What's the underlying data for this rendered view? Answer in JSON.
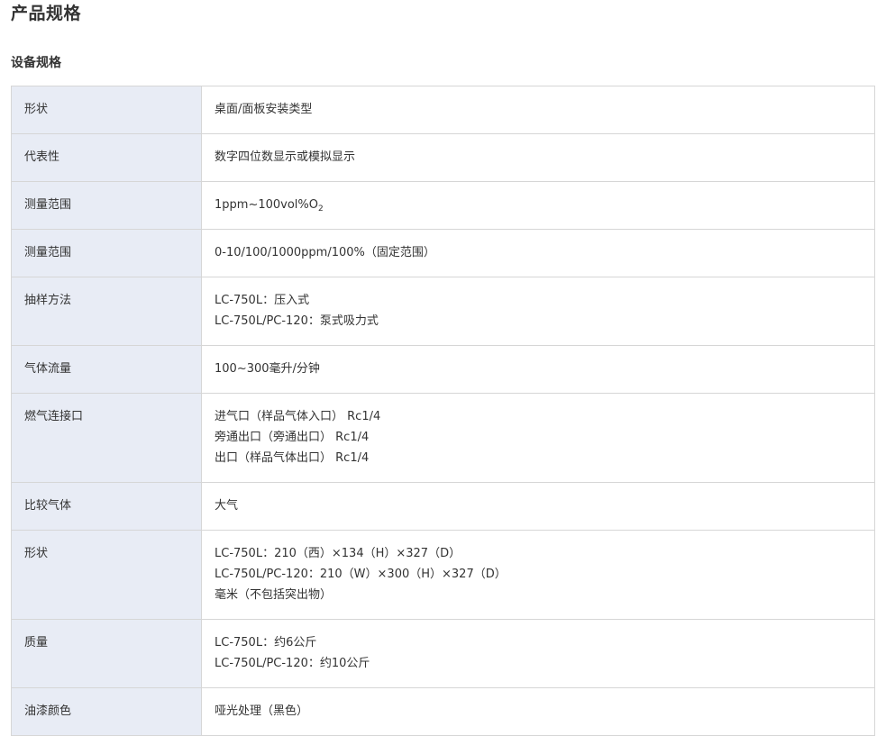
{
  "page_title": "产品规格",
  "section_title": "设备规格",
  "rows": [
    {
      "label": "形状",
      "lines": [
        "桌面/面板安装类型"
      ]
    },
    {
      "label": "代表性",
      "lines": [
        "数字四位数显示或模拟显示"
      ]
    },
    {
      "label": "测量范围",
      "value_main": "1ppm~100vol%O",
      "value_sub": "2"
    },
    {
      "label": "测量范围",
      "lines": [
        "0-10/100/1000ppm/100%（固定范围）"
      ]
    },
    {
      "label": "抽样方法",
      "lines": [
        "LC-750L：压入式",
        "LC-750L/PC-120：泵式吸力式"
      ]
    },
    {
      "label": "气体流量",
      "lines": [
        "100~300毫升/分钟"
      ]
    },
    {
      "label": "燃气连接口",
      "lines": [
        "进气口（样品气体入口） Rc1/4",
        "旁通出口（旁通出口） Rc1/4",
        "出口（样品气体出口） Rc1/4"
      ]
    },
    {
      "label": "比较气体",
      "lines": [
        "大气"
      ]
    },
    {
      "label": "形状",
      "lines": [
        "LC-750L：210（西）×134（H）×327（D）",
        "LC-750L/PC-120：210（W）×300（H）×327（D）",
        "毫米（不包括突出物）"
      ]
    },
    {
      "label": "质量",
      "lines": [
        "LC-750L：约6公斤",
        "LC-750L/PC-120：约10公斤"
      ]
    },
    {
      "label": "油漆颜色",
      "lines": [
        "哑光处理（黑色）"
      ]
    }
  ]
}
